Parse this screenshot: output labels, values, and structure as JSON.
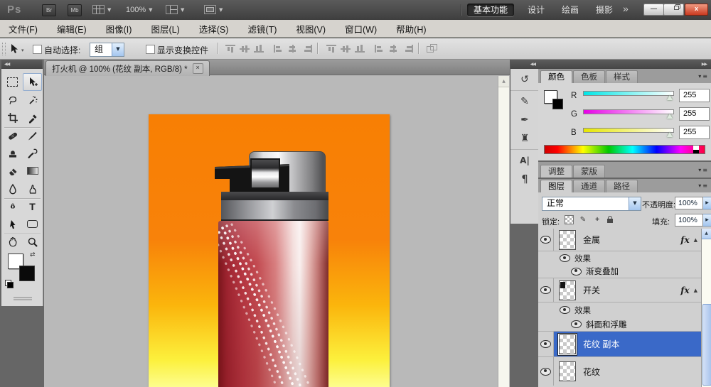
{
  "glyphs": {
    "collapse_left": "◀◀",
    "expand_right": "▶▶",
    "dropdown": "▼",
    "caret": "▾",
    "spin": "▶",
    "up": "▲",
    "menu_lines": "≡",
    "tab_close": "×",
    "win_min": "—",
    "fx": "fx",
    "type_tool": "T",
    "character": "A|",
    "paragraph": "¶",
    "history": "↺",
    "brushes": "✎",
    "tool_presets": "✒",
    "clone_source": "♜",
    "swap": "⇄",
    "plus": "+"
  },
  "app_bar": {
    "logo": "Ps",
    "br": "Br",
    "mb": "Mb",
    "zoom": "100%",
    "workspaces": [
      "基本功能",
      "设计",
      "绘画",
      "摄影"
    ],
    "overflow": "»",
    "win_close": "x"
  },
  "menu": {
    "items": [
      "文件(F)",
      "编辑(E)",
      "图像(I)",
      "图层(L)",
      "选择(S)",
      "滤镜(T)",
      "视图(V)",
      "窗口(W)",
      "帮助(H)"
    ]
  },
  "options": {
    "auto_select_label": "自动选择:",
    "auto_select_value": "组",
    "show_transform_label": "显示变换控件"
  },
  "document": {
    "tab_title": "打火机 @ 100% (花纹 副本, RGB/8) *"
  },
  "color_panel": {
    "tabs": [
      "颜色",
      "色板",
      "样式"
    ],
    "channels": [
      {
        "label": "R",
        "value": "255"
      },
      {
        "label": "G",
        "value": "255"
      },
      {
        "label": "B",
        "value": "255"
      }
    ]
  },
  "adjust_panel": {
    "tabs": [
      "调整",
      "蒙版"
    ]
  },
  "layers_panel": {
    "tabs": [
      "图层",
      "通道",
      "路径"
    ],
    "blend_mode": "正常",
    "opacity_label": "不透明度:",
    "opacity_value": "100%",
    "lock_label": "锁定:",
    "fill_label": "填充:",
    "fill_value": "100%",
    "rows": [
      {
        "name": "金属"
      },
      {
        "name": "效果"
      },
      {
        "name": "渐变叠加"
      },
      {
        "name": "开关"
      },
      {
        "name": "效果"
      },
      {
        "name": "斜面和浮雕"
      },
      {
        "name": "花纹 副本"
      },
      {
        "name": "花纹"
      }
    ]
  },
  "canvas_colors": {
    "bg_top": "#f87f03",
    "bg_bottom": "#fdfd8e",
    "body_red": "#b63742",
    "selection_blue": "#3a69c8"
  }
}
